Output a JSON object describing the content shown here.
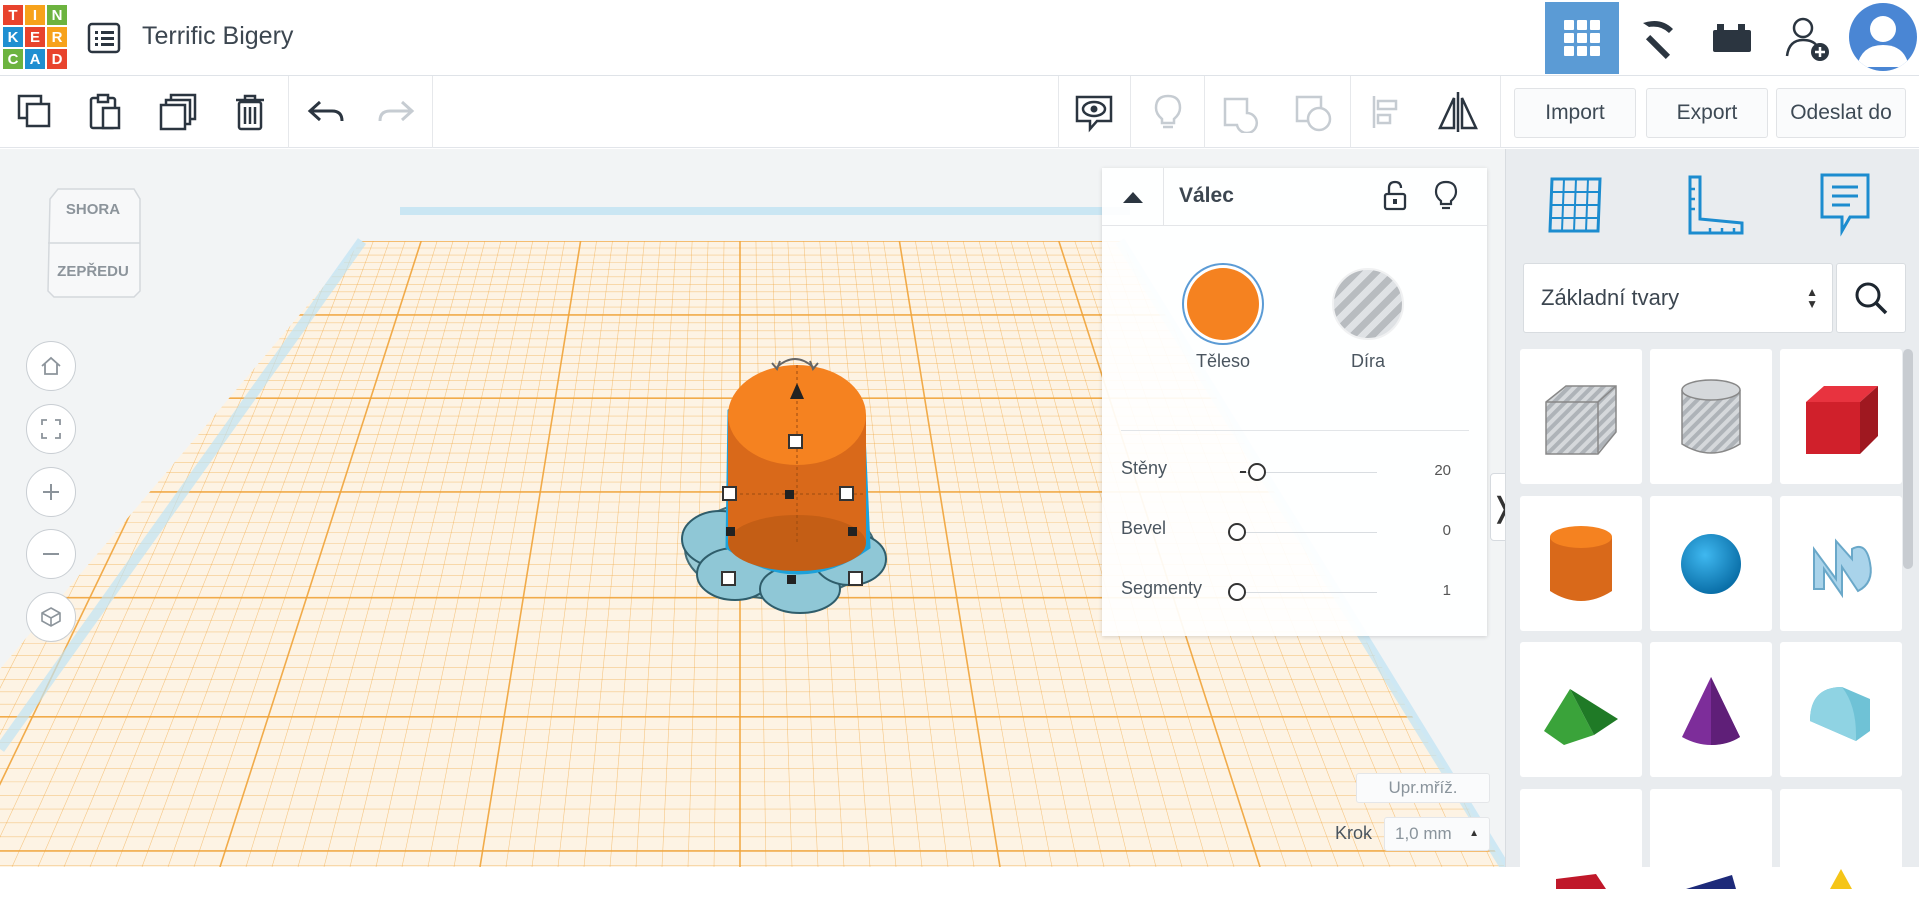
{
  "app": {
    "logo_letters": [
      "T",
      "I",
      "N",
      "K",
      "E",
      "R",
      "C",
      "A",
      "D"
    ],
    "project_title": "Terrific Bigery"
  },
  "toolbar": {
    "import_label": "Import",
    "export_label": "Export",
    "send_label": "Odeslat do"
  },
  "viewcube": {
    "top_label": "SHORA",
    "front_label": "ZEPŘEDU"
  },
  "inspector": {
    "title": "Válec",
    "solid_label": "Těleso",
    "hole_label": "Díra",
    "params": [
      {
        "label": "Stěny",
        "value": "20"
      },
      {
        "label": "Bevel",
        "value": "0"
      },
      {
        "label": "Segmenty",
        "value": "1"
      }
    ]
  },
  "workplane": {
    "grid_settings_label": "Upr.mříž.",
    "snap_label": "Krok",
    "snap_value": "1,0 mm"
  },
  "sidebar": {
    "category": "Základní tvary",
    "shapes": [
      "box-hole-icon",
      "cylinder-hole-icon",
      "box-icon",
      "cylinder-icon",
      "sphere-icon",
      "text-icon",
      "roof-icon",
      "cone-icon",
      "round-roof-icon"
    ]
  },
  "colors": {
    "accent": "#5b9bd5",
    "solid": "#f58220",
    "grid": "#f0a43a"
  }
}
